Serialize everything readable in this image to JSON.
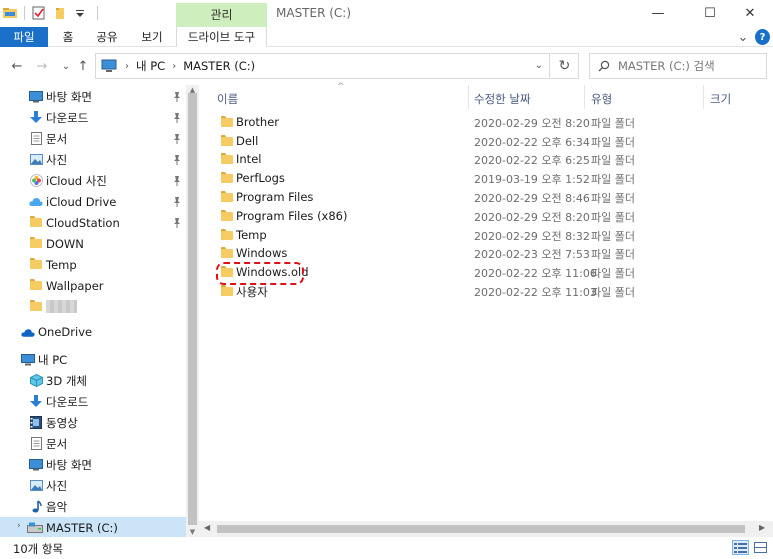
{
  "window": {
    "title": "MASTER (C:)",
    "minimize": "—",
    "maximize": "☐",
    "close": "✕"
  },
  "ribbon": {
    "context_header": "관리",
    "tabs": [
      "파일",
      "홈",
      "공유",
      "보기"
    ],
    "context_tab": "드라이브 도구",
    "expand_glyph": "⌄",
    "help_glyph": "?"
  },
  "nav": {
    "back": "←",
    "forward": "→",
    "recent": "⌄",
    "up": "↑",
    "breadcrumb": [
      "내 PC",
      "MASTER (C:)"
    ],
    "crumb_sep": "›",
    "refresh": "↻",
    "search_placeholder": "MASTER (C:) 검색"
  },
  "sidebar": {
    "quick_access": [
      {
        "label": "바탕 화면",
        "icon": "desktop-icon",
        "pinned": true
      },
      {
        "label": "다운로드",
        "icon": "download-icon",
        "pinned": true
      },
      {
        "label": "문서",
        "icon": "document-icon",
        "pinned": true
      },
      {
        "label": "사진",
        "icon": "pictures-icon",
        "pinned": true
      },
      {
        "label": "iCloud 사진",
        "icon": "icloud-photos-icon",
        "pinned": true
      },
      {
        "label": "iCloud Drive",
        "icon": "icloud-drive-icon",
        "pinned": true
      },
      {
        "label": "CloudStation",
        "icon": "folder-icon",
        "pinned": true
      },
      {
        "label": "DOWN",
        "icon": "folder-icon",
        "pinned": false
      },
      {
        "label": "Temp",
        "icon": "folder-icon",
        "pinned": false
      },
      {
        "label": "Wallpaper",
        "icon": "folder-icon",
        "pinned": false
      }
    ],
    "onedrive": "OneDrive",
    "this_pc": "내 PC",
    "this_pc_items": [
      {
        "label": "3D 개체",
        "icon": "3d-objects-icon"
      },
      {
        "label": "다운로드",
        "icon": "download-icon"
      },
      {
        "label": "동영상",
        "icon": "videos-icon"
      },
      {
        "label": "문서",
        "icon": "document-icon"
      },
      {
        "label": "바탕 화면",
        "icon": "desktop-icon"
      },
      {
        "label": "사진",
        "icon": "pictures-icon"
      },
      {
        "label": "음악",
        "icon": "music-icon"
      },
      {
        "label": "MASTER (C:)",
        "icon": "drive-icon",
        "selected": true
      }
    ]
  },
  "columns": {
    "name": "이름",
    "date": "수정한 날짜",
    "type": "유형",
    "size": "크기",
    "sort_glyph": "^"
  },
  "files": [
    {
      "name": "Brother",
      "date": "2020-02-29 오전 8:20",
      "type": "파일 폴더"
    },
    {
      "name": "Dell",
      "date": "2020-02-22 오후 6:34",
      "type": "파일 폴더"
    },
    {
      "name": "Intel",
      "date": "2020-02-22 오후 6:25",
      "type": "파일 폴더"
    },
    {
      "name": "PerfLogs",
      "date": "2019-03-19 오후 1:52",
      "type": "파일 폴더"
    },
    {
      "name": "Program Files",
      "date": "2020-02-29 오전 8:46",
      "type": "파일 폴더"
    },
    {
      "name": "Program Files (x86)",
      "date": "2020-02-29 오전 8:20",
      "type": "파일 폴더"
    },
    {
      "name": "Temp",
      "date": "2020-02-29 오전 8:32",
      "type": "파일 폴더"
    },
    {
      "name": "Windows",
      "date": "2020-02-23 오전 7:53",
      "type": "파일 폴더"
    },
    {
      "name": "Windows.old",
      "date": "2020-02-22 오후 11:06",
      "type": "파일 폴더"
    },
    {
      "name": "사용자",
      "date": "2020-02-22 오후 11:03",
      "type": "파일 폴더"
    }
  ],
  "status": {
    "count": "10개 항목"
  },
  "colors": {
    "accent": "#1a70c8",
    "context_tab": "#cfeebd",
    "folder": "#f6cc62",
    "selection": "#cce4f7",
    "highlight_ring": "#e0101a"
  }
}
